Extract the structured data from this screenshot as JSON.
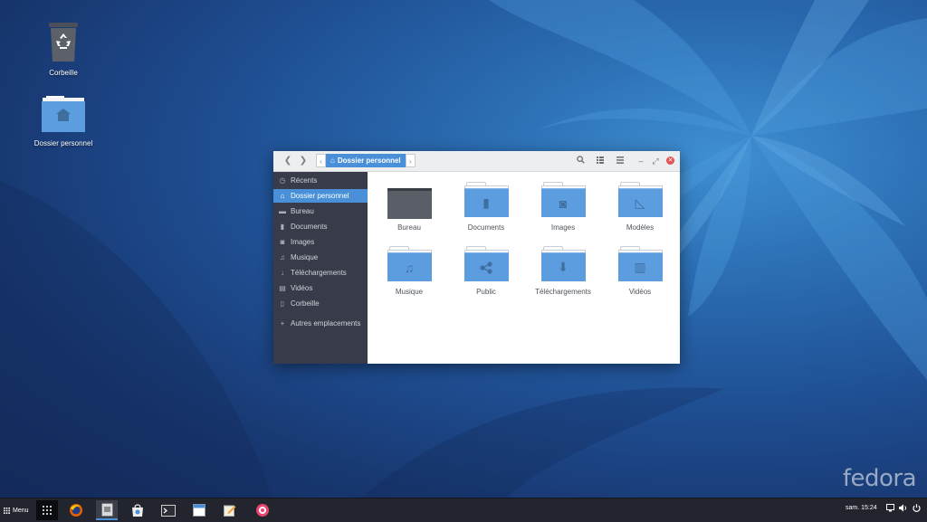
{
  "desktop": {
    "icons": [
      {
        "label": "Corbeille"
      },
      {
        "label": "Dossier personnel"
      }
    ],
    "brand": "fedora"
  },
  "window": {
    "path": {
      "current": "Dossier personnel"
    },
    "sidebar": [
      {
        "label": "Récents",
        "icon": "clock-icon"
      },
      {
        "label": "Dossier personnel",
        "icon": "home-icon",
        "active": true
      },
      {
        "label": "Bureau",
        "icon": "desktop-icon"
      },
      {
        "label": "Documents",
        "icon": "document-icon"
      },
      {
        "label": "Images",
        "icon": "camera-icon"
      },
      {
        "label": "Musique",
        "icon": "music-note-icon"
      },
      {
        "label": "Téléchargements",
        "icon": "download-icon"
      },
      {
        "label": "Vidéos",
        "icon": "film-icon"
      },
      {
        "label": "Corbeille",
        "icon": "trash-icon"
      },
      {
        "label": "Autres emplacements",
        "icon": "plus-icon"
      }
    ],
    "folders": [
      {
        "label": "Bureau",
        "icon": "desktop-icon"
      },
      {
        "label": "Documents",
        "icon": "document-icon"
      },
      {
        "label": "Images",
        "icon": "camera-icon"
      },
      {
        "label": "Modèles",
        "icon": "ruler-icon"
      },
      {
        "label": "Musique",
        "icon": "music-note-icon"
      },
      {
        "label": "Public",
        "icon": "share-icon"
      },
      {
        "label": "Téléchargements",
        "icon": "download-icon"
      },
      {
        "label": "Vidéos",
        "icon": "film-icon"
      }
    ]
  },
  "taskbar": {
    "menu_label": "Menu",
    "clock": "sam. 15:24",
    "apps": [
      "grid-icon",
      "firefox-icon",
      "files-icon",
      "software-icon",
      "terminal-icon",
      "calendar-icon",
      "text-editor-icon",
      "lollypop-icon"
    ]
  },
  "colors": {
    "accent": "#4a90d9",
    "sidebar": "#383c4a",
    "folder": "#5c9de0"
  }
}
